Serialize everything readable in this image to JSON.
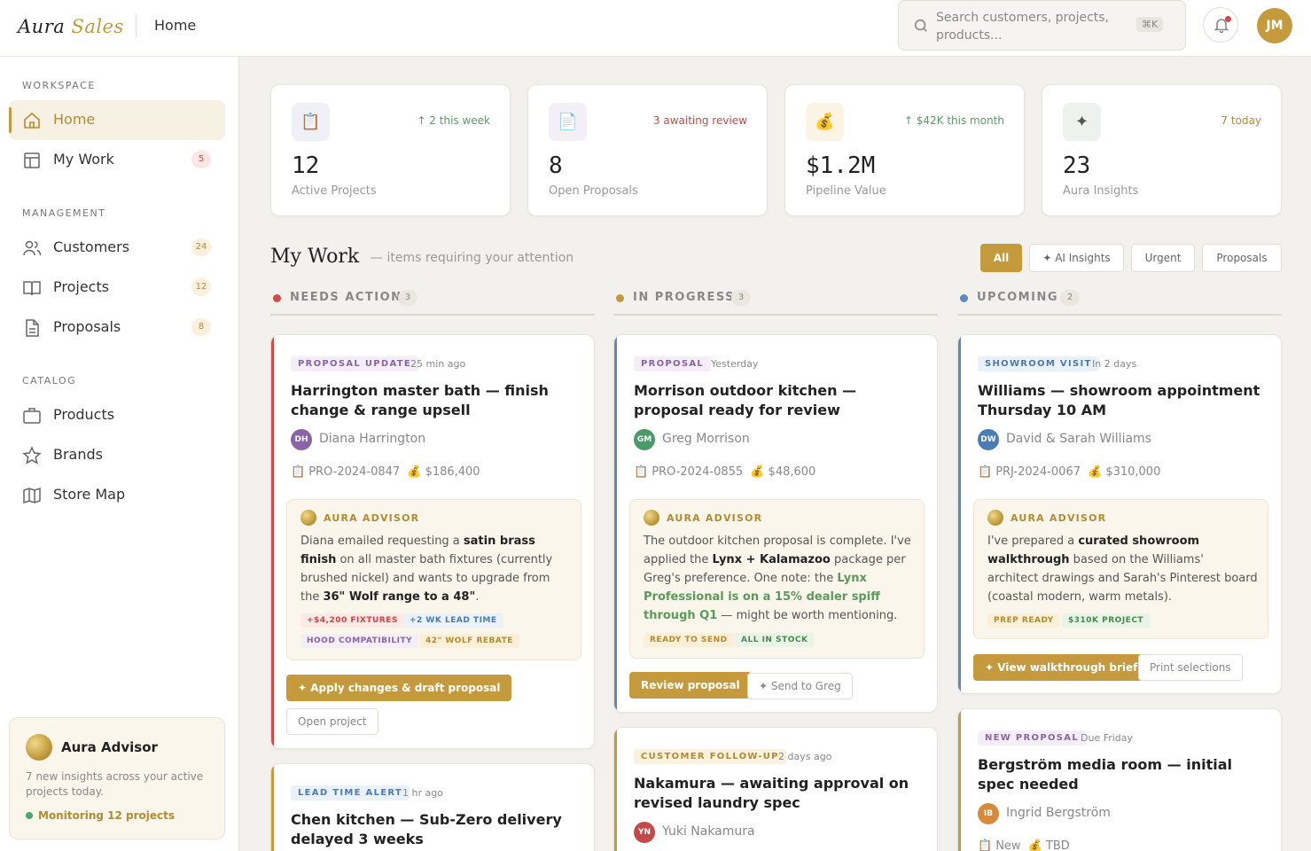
{
  "app": {
    "brand_a": "Aura",
    "brand_b": "Sales",
    "breadcrumb": "Home"
  },
  "search": {
    "placeholder": "Search customers, projects, products...",
    "shortcut": "⌘K"
  },
  "user": {
    "initials": "JM"
  },
  "sidebar": {
    "workspace_label": "WORKSPACE",
    "management_label": "MANAGEMENT",
    "catalog_label": "CATALOG",
    "items": [
      {
        "label": "Home",
        "icon": "home-icon"
      },
      {
        "label": "My Work",
        "icon": "layout-icon",
        "count": "5"
      },
      {
        "label": "Customers",
        "icon": "users-icon",
        "count": "24"
      },
      {
        "label": "Projects",
        "icon": "book-icon",
        "count": "12"
      },
      {
        "label": "Proposals",
        "icon": "document-icon",
        "count": "8"
      },
      {
        "label": "Products",
        "icon": "briefcase-icon"
      },
      {
        "label": "Brands",
        "icon": "star-icon"
      },
      {
        "label": "Store Map",
        "icon": "map-icon"
      }
    ],
    "advisor": {
      "title": "Aura Advisor",
      "desc": "7 new insights across your active projects today.",
      "status": "Monitoring 12 projects"
    }
  },
  "stats": [
    {
      "icon": "📋",
      "trend": "↑ 2 this week",
      "value": "12",
      "label": "Active Projects",
      "trend_color": "#5a9a6a",
      "icon_bg": "#efeff8"
    },
    {
      "icon": "📄",
      "trend": "3 awaiting review",
      "value": "8",
      "label": "Open Proposals",
      "trend_color": "#c44a4a",
      "icon_bg": "#f3eff7"
    },
    {
      "icon": "💰",
      "trend": "↑ $42K this month",
      "value": "$1.2M",
      "label": "Pipeline Value",
      "trend_color": "#5a9a6a",
      "icon_bg": "#fbf3e3"
    },
    {
      "icon": "✦",
      "trend": "7 today",
      "value": "23",
      "label": "Aura Insights",
      "trend_color": "#b48b30",
      "icon_bg": "#eef2ef"
    }
  ],
  "mywork": {
    "title": "My Work",
    "subtitle": "— items requiring your attention",
    "filters": [
      "All",
      "✦ AI Insights",
      "Urgent",
      "Proposals"
    ]
  },
  "columns": [
    {
      "name": "NEEDS ACTION",
      "count": "3",
      "color": "#d24a4a"
    },
    {
      "name": "IN PROGRESS",
      "count": "3",
      "color": "#c59a3d"
    },
    {
      "name": "UPCOMING",
      "count": "2",
      "color": "#5a8ac4"
    }
  ],
  "cards": {
    "c1": {
      "tag": "PROPOSAL UPDATE",
      "when": "25 min ago",
      "title": "Harrington master bath — finish change & range upsell",
      "initials": "DH",
      "person": "Diana Harrington",
      "ref": "PRO-2024-0847",
      "amount": "$186,400",
      "advisor_label": "AURA ADVISOR",
      "chips": [
        "+$4,200 FIXTURES",
        "+2 WK LEAD TIME",
        "HOOD COMPATIBILITY",
        "42\" WOLF REBATE"
      ],
      "btn1": "✦ Apply changes & draft proposal",
      "btn2": "Open project"
    },
    "c2": {
      "tag": "PROPOSAL",
      "when": "Yesterday",
      "title": "Morrison outdoor kitchen — proposal ready for review",
      "initials": "GM",
      "person": "Greg Morrison",
      "ref": "PRO-2024-0855",
      "amount": "$48,600",
      "advisor_label": "AURA ADVISOR",
      "chips": [
        "READY TO SEND",
        "ALL IN STOCK"
      ],
      "btn1": "Review proposal",
      "btn2": "✦ Send to Greg"
    },
    "c3": {
      "tag": "SHOWROOM VISIT",
      "when": "In 2 days",
      "title": "Williams — showroom appointment Thursday 10 AM",
      "initials": "DW",
      "person": "David & Sarah Williams",
      "ref": "PRJ-2024-0067",
      "amount": "$310,000",
      "advisor_label": "AURA ADVISOR",
      "chips": [
        "PREP READY",
        "$310K PROJECT"
      ],
      "btn1": "✦ View walkthrough brief",
      "btn2": "Print selections"
    },
    "c4": {
      "tag": "LEAD TIME ALERT",
      "when": "1 hr ago",
      "title": "Chen kitchen — Sub-Zero delivery delayed 3 weeks"
    },
    "c5": {
      "tag": "CUSTOMER FOLLOW-UP",
      "when": "2 days ago",
      "title": "Nakamura — awaiting approval on revised laundry spec",
      "initials": "YN",
      "person": "Yuki Nakamura"
    },
    "c6": {
      "tag": "NEW PROPOSAL",
      "when": "Due Friday",
      "title": "Bergström media room — initial spec needed",
      "initials": "IB",
      "person": "Ingrid Bergström",
      "ref": "New",
      "amount": "TBD"
    }
  },
  "advisor_text": {
    "c1": {
      "p1": "Diana emailed requesting a ",
      "b1": "satin brass finish",
      "p2": " on all master bath fixtures (currently brushed nickel) and wants to upgrade from the ",
      "b2": "36\" Wolf range to a 48\"",
      "p3": "."
    },
    "c2": {
      "p1": "The outdoor kitchen proposal is complete. I've applied the ",
      "b1": "Lynx + Kalamazoo",
      "p2": " package per Greg's preference. One note: the ",
      "g1": "Lynx Professional is on a 15% dealer spiff through Q1",
      "p3": " — might be worth mentioning."
    },
    "c3": {
      "p1": "I've prepared a ",
      "b1": "curated showroom walkthrough",
      "p2": " based on the Williams' architect drawings and Sarah's Pinterest board (coastal modern, warm metals)."
    }
  }
}
